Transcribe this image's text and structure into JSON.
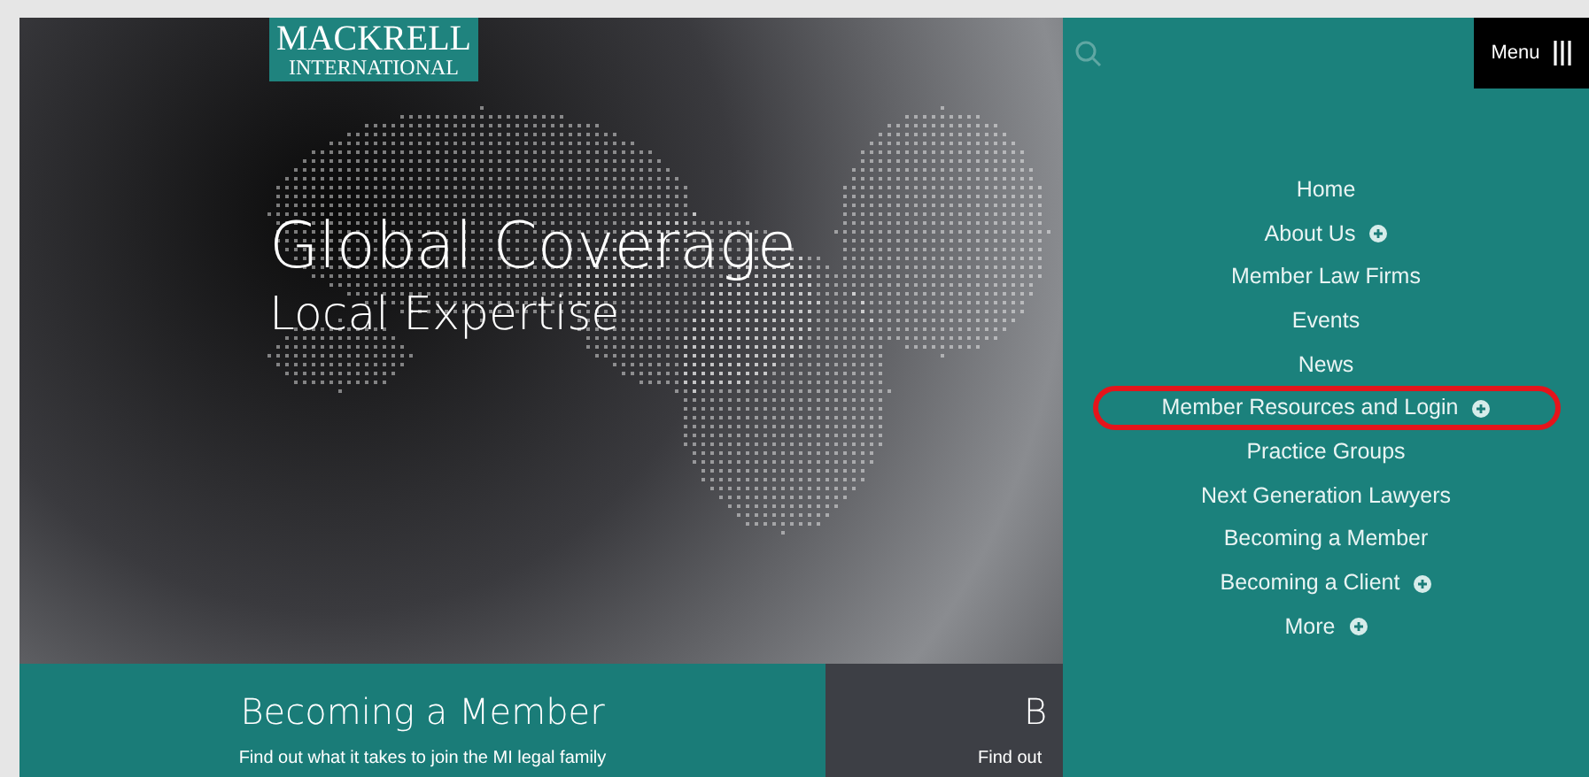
{
  "logo": {
    "line1": "MACKRELL",
    "line2": "INTERNATIONAL"
  },
  "hero": {
    "title": "Global Coverage",
    "subtitle": "Local Expertise"
  },
  "cards": [
    {
      "kind": "member",
      "title": "Becoming a Member",
      "text": "Find out what it takes to join the MI legal family"
    },
    {
      "kind": "client",
      "title": "B",
      "text": "Find out"
    }
  ],
  "menu_button": {
    "label": "Menu"
  },
  "menu": [
    {
      "label": "Home",
      "expandable": false,
      "highlighted": false
    },
    {
      "label": "About Us",
      "expandable": true,
      "highlighted": false
    },
    {
      "label": "Member Law Firms",
      "expandable": false,
      "highlighted": false
    },
    {
      "label": "Events",
      "expandable": false,
      "highlighted": false
    },
    {
      "label": "News",
      "expandable": false,
      "highlighted": false
    },
    {
      "label": "Member Resources and Login",
      "expandable": true,
      "highlighted": true
    },
    {
      "label": "Practice Groups",
      "expandable": false,
      "highlighted": false
    },
    {
      "label": "Next Generation Lawyers",
      "expandable": false,
      "highlighted": false
    },
    {
      "label": "Becoming a Member",
      "expandable": false,
      "highlighted": false
    },
    {
      "label": "Becoming a Client",
      "expandable": true,
      "highlighted": false
    },
    {
      "label": "More",
      "expandable": true,
      "highlighted": false
    }
  ]
}
